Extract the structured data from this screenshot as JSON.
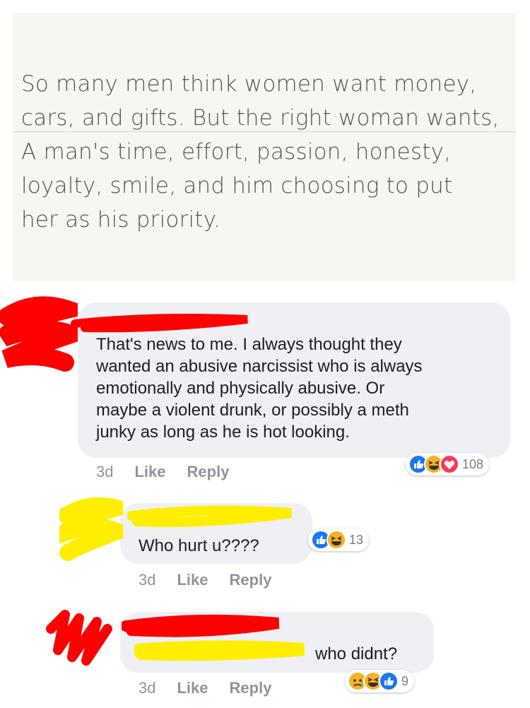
{
  "quote": {
    "lines": [
      "So many men think women want money,",
      "cars, and gifts. But the right woman wants,",
      "A man's time, effort, passion, honesty,",
      "loyalty, smile, and him choosing to put",
      "her as his priority."
    ]
  },
  "comments": [
    {
      "text_lines": [
        "That's news to me. I always thought they",
        "wanted an abusive narcissist who is always",
        "emotionally and physically abusive. Or",
        "maybe a violent drunk, or possibly a meth",
        "junky as long as he is hot looking."
      ],
      "age": "3d",
      "like_label": "Like",
      "reply_label": "Reply",
      "reaction_count": "108",
      "reactions": [
        "like-icon",
        "haha-icon",
        "love-icon"
      ]
    },
    {
      "text": "Who hurt u????",
      "age": "3d",
      "like_label": "Like",
      "reply_label": "Reply",
      "reaction_count": "13",
      "reactions": [
        "like-icon",
        "haha-icon"
      ]
    },
    {
      "text": "who didnt?",
      "age": "3d",
      "like_label": "Like",
      "reply_label": "Reply",
      "reaction_count": "9",
      "reactions": [
        "sad-icon",
        "haha-icon",
        "like-icon"
      ]
    }
  ],
  "colors": {
    "like_blue": "#1877f2",
    "love_red": "#f33e58",
    "haha_yellow": "#f7b125",
    "redaction_red": "#ff0000",
    "redaction_yellow": "#ffee00"
  }
}
